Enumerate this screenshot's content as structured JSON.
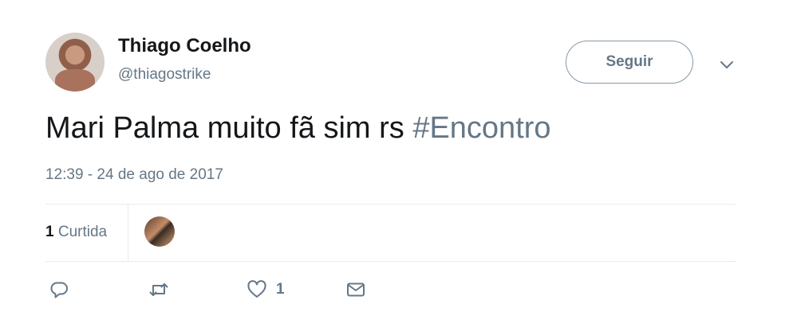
{
  "author": {
    "name": "Thiago Coelho",
    "handle": "@thiagostrike"
  },
  "follow_button": {
    "label": "Seguir"
  },
  "tweet": {
    "text": "Mari Palma muito fã sim rs ",
    "hashtag": "#Encontro",
    "timestamp": "12:39 - 24 de ago de 2017"
  },
  "stats": {
    "likes_number": "1",
    "likes_label": " Curtida"
  },
  "actions": {
    "like_count": "1"
  },
  "icons": {
    "menu": "chevron-down-icon",
    "reply": "reply-icon",
    "retweet": "retweet-icon",
    "like": "heart-icon",
    "dm": "envelope-icon"
  },
  "colors": {
    "text_primary": "#14171a",
    "text_secondary": "#657786",
    "divider": "#e6ecf0"
  }
}
